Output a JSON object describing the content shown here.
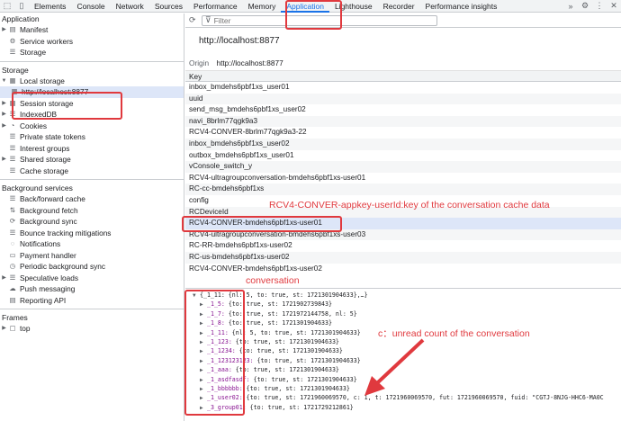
{
  "tabs": [
    "Elements",
    "Console",
    "Network",
    "Sources",
    "Performance",
    "Memory",
    "Application",
    "Lighthouse",
    "Recorder",
    "Performance insights"
  ],
  "active_tab": "Application",
  "sidebar": {
    "application_title": "Application",
    "application_items": [
      "Manifest",
      "Service workers",
      "Storage"
    ],
    "storage_title": "Storage",
    "local_storage": "Local storage",
    "local_storage_child": "http://localhost:8877",
    "storage_items": [
      "Session storage",
      "IndexedDB",
      "Cookies",
      "Private state tokens",
      "Interest groups",
      "Shared storage",
      "Cache storage"
    ],
    "bg_title": "Background services",
    "bg_items": [
      "Back/forward cache",
      "Background fetch",
      "Background sync",
      "Bounce tracking mitigations",
      "Notifications",
      "Payment handler",
      "Periodic background sync",
      "Speculative loads",
      "Push messaging",
      "Reporting API"
    ],
    "frames_title": "Frames",
    "frames_items": [
      "top"
    ]
  },
  "main": {
    "filter_placeholder": "Filter",
    "origin_title": "http://localhost:8877",
    "origin_label": "Origin",
    "origin_value": "http://localhost:8877",
    "key_header": "Key",
    "keys": [
      "inbox_bmdehs6pbf1xs_user01",
      "uuid",
      "send_msg_bmdehs6pbf1xs_user02",
      "navi_8brlm77qgk9a3",
      "RCV4-CONVER-8brlm77qgk9a3-22",
      "inbox_bmdehs6pbf1xs_user02",
      "outbox_bmdehs6pbf1xs_user01",
      "vConsole_switch_y",
      "RCV4-ultragroupconversation-bmdehs6pbf1xs-user01",
      "RC-cc-bmdehs6pbf1xs",
      "config",
      "RCDeviceId",
      "RCV4-CONVER-bmdehs6pbf1xs-user01",
      "RCV4-ultragroupconversation-bmdehs6pbf1xs-user03",
      "RC-RR-bmdehs6pbf1xs-user02",
      "RC-us-bmdehs6pbf1xs-user02",
      "RCV4-CONVER-bmdehs6pbf1xs-user02"
    ],
    "value_lines": [
      {
        "indent": 0,
        "k": "{_1_11:",
        "v": " {nl: 5, to: true, st: 1721301904633},…}"
      },
      {
        "indent": 1,
        "k": "_1_5:",
        "v": " {to: true, st: 1721902739843}"
      },
      {
        "indent": 1,
        "k": "_1_7:",
        "v": " {to: true, st: 1721972144758, nl: 5}"
      },
      {
        "indent": 1,
        "k": "_1_8:",
        "v": " {to: true, st: 1721301904633}"
      },
      {
        "indent": 1,
        "k": "_1_11:",
        "v": " {nl: 5, to: true, st: 1721301904633}"
      },
      {
        "indent": 1,
        "k": "_1_123:",
        "v": " {to: true, st: 1721301904633}"
      },
      {
        "indent": 1,
        "k": "_1_1234:",
        "v": " {to: true, st: 1721301904633}"
      },
      {
        "indent": 1,
        "k": "_1_123123123:",
        "v": " {to: true, st: 1721301904633}"
      },
      {
        "indent": 1,
        "k": "_1_aaa:",
        "v": " {to: true, st: 1721301904633}"
      },
      {
        "indent": 1,
        "k": "_1_asdfasdf:",
        "v": " {to: true, st: 1721301904633}"
      },
      {
        "indent": 1,
        "k": "_1_bbbbbb:",
        "v": " {to: true, st: 1721301904633}"
      },
      {
        "indent": 1,
        "k": "_1_user02:",
        "v": " {to: true, st: 1721960069570, c: 1, t: 1721960069570, fut: 1721960069570, fuid: \"CGTJ-8NJG-HHC6-MA0C"
      },
      {
        "indent": 1,
        "k": "_3_group01:",
        "v": " {to: true, st: 1721729212861}"
      }
    ]
  },
  "annotations": {
    "key_label": "RCV4-CONVER-appkey-userId:key of the conversation cache data",
    "conversation_label": "conversation",
    "unread_label": "c：unread count of the conversation",
    "color": "#e0393e"
  }
}
